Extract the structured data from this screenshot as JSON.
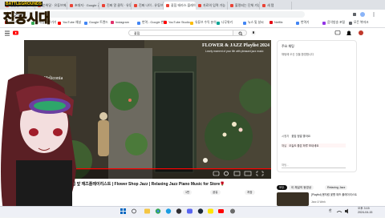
{
  "browser": {
    "tabs": [
      {
        "label": "선물된 · 유튜브에서 플레이",
        "active": false
      },
      {
        "label": "순위달 · 유튜브에서 플레이",
        "active": false
      },
      {
        "label": "초대자 · Google 검색",
        "active": false
      },
      {
        "label": "진짜 알 클릭 · 유튜브 채널",
        "active": false
      },
      {
        "label": "진짜 나이 - 유튜브 채널",
        "active": false
      },
      {
        "label": "꽃집 테라스 플레이",
        "active": true
      },
      {
        "label": "자료의 입력 가능",
        "active": false
      },
      {
        "label": "불명되는 단체 가능",
        "active": false
      },
      {
        "label": "새 탭",
        "active": false
      }
    ],
    "bookmarks": [
      {
        "label": "YouTube",
        "color": "#ff0000"
      },
      {
        "label": "마케팅 바로가기",
        "color": "#34a853"
      },
      {
        "label": "YouTube 채널",
        "color": "#ff0000"
      },
      {
        "label": "Google 트렌드",
        "color": "#4285f4"
      },
      {
        "label": "Instagram",
        "color": "#e1306c"
      },
      {
        "label": "번역 - Google 번역",
        "color": "#4285f4"
      },
      {
        "label": "YouTube Studio",
        "color": "#ff0000"
      },
      {
        "label": "유튜브 수익 분석",
        "color": "#fbbc04"
      },
      {
        "label": "나무위키",
        "color": "#00a495"
      },
      {
        "label": "뉴스 및 날씨",
        "color": "#4285f4"
      },
      {
        "label": "Netflix",
        "color": "#e50914"
      },
      {
        "label": "번역기",
        "color": "#4285f4"
      },
      {
        "label": "음악방송 포털",
        "color": "#9334e6"
      },
      {
        "label": "모든 북마크",
        "color": "#5f6368"
      }
    ]
  },
  "youtube": {
    "search_text": "꽃집",
    "video": {
      "overlay_title": "FLOWER & JAZZ Playlist 2024",
      "overlay_sub": "Lovely moment of your life with pleasant jazz music",
      "shop_sign": "Heliconia",
      "title": "꽃집 앞 재즈플레이리스트 | Flower Shop Jazz | Relaxing Jazz Piano Music for Store🌹",
      "actions": [
        "1만",
        "공유",
        "저장"
      ]
    },
    "chat": {
      "header": "주요 채팅",
      "notice": "채팅에 오신 것을 환영합니다",
      "messages": [
        {
          "user": "시청자",
          "text": "꽃집 정말 좋아요"
        },
        {
          "user": "채널",
          "text": "오늘도 좋은 하루 보내세요"
        }
      ],
      "input_placeholder": "채팅...",
      "show_chat": "채팅 표시"
    },
    "chips": [
      "모두",
      "이 채널의 동영상",
      "Relaxing Jazz"
    ],
    "recommendations": [
      {
        "title": "[Playlist] 봄처럼 꽃향 재즈 플레이리스트",
        "channel": "Jazz & Work"
      }
    ]
  },
  "overlay": {
    "game_logo_top": "BATTLEGROUNDS",
    "game_logo_main": "진공시대"
  },
  "taskbar": {
    "time": "오후 3:15",
    "date": "2024-04-15",
    "lang": "한"
  },
  "colors": {
    "accent": "#ff0000",
    "tab_bar": "#dee1e6"
  }
}
